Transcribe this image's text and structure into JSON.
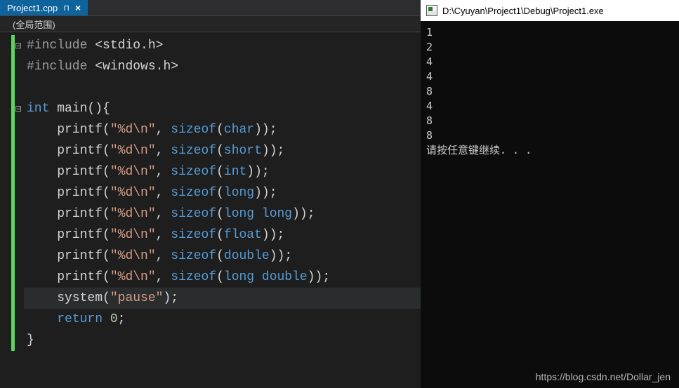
{
  "tab": {
    "filename": "Project1.cpp",
    "close": "×",
    "pin": "⊓"
  },
  "scope": {
    "label": "(全局范围)"
  },
  "code": {
    "lines": [
      {
        "fold": "⊟",
        "tokens": [
          [
            "pre",
            "#include"
          ],
          [
            "id",
            " "
          ],
          [
            "ang",
            "<stdio.h>"
          ]
        ]
      },
      {
        "fold": "",
        "tokens": [
          [
            "pre",
            "#include"
          ],
          [
            "id",
            " "
          ],
          [
            "ang",
            "<windows.h>"
          ]
        ]
      },
      {
        "fold": "",
        "tokens": []
      },
      {
        "fold": "⊟",
        "tokens": [
          [
            "kw",
            "int"
          ],
          [
            "id",
            " main"
          ],
          [
            "punc",
            "()"
          ],
          [
            "punc",
            "{"
          ]
        ]
      },
      {
        "fold": "",
        "tokens": [
          [
            "id",
            "    printf"
          ],
          [
            "punc",
            "("
          ],
          [
            "str",
            "\"%d\\n\""
          ],
          [
            "punc",
            ", "
          ],
          [
            "kw",
            "sizeof"
          ],
          [
            "punc",
            "("
          ],
          [
            "kw",
            "char"
          ],
          [
            "punc",
            "))"
          ],
          [
            "punc",
            ";"
          ]
        ]
      },
      {
        "fold": "",
        "tokens": [
          [
            "id",
            "    printf"
          ],
          [
            "punc",
            "("
          ],
          [
            "str",
            "\"%d\\n\""
          ],
          [
            "punc",
            ", "
          ],
          [
            "kw",
            "sizeof"
          ],
          [
            "punc",
            "("
          ],
          [
            "kw",
            "short"
          ],
          [
            "punc",
            "))"
          ],
          [
            "punc",
            ";"
          ]
        ]
      },
      {
        "fold": "",
        "tokens": [
          [
            "id",
            "    printf"
          ],
          [
            "punc",
            "("
          ],
          [
            "str",
            "\"%d\\n\""
          ],
          [
            "punc",
            ", "
          ],
          [
            "kw",
            "sizeof"
          ],
          [
            "punc",
            "("
          ],
          [
            "kw",
            "int"
          ],
          [
            "punc",
            "))"
          ],
          [
            "punc",
            ";"
          ]
        ]
      },
      {
        "fold": "",
        "tokens": [
          [
            "id",
            "    printf"
          ],
          [
            "punc",
            "("
          ],
          [
            "str",
            "\"%d\\n\""
          ],
          [
            "punc",
            ", "
          ],
          [
            "kw",
            "sizeof"
          ],
          [
            "punc",
            "("
          ],
          [
            "kw",
            "long"
          ],
          [
            "punc",
            "))"
          ],
          [
            "punc",
            ";"
          ]
        ]
      },
      {
        "fold": "",
        "tokens": [
          [
            "id",
            "    printf"
          ],
          [
            "punc",
            "("
          ],
          [
            "str",
            "\"%d\\n\""
          ],
          [
            "punc",
            ", "
          ],
          [
            "kw",
            "sizeof"
          ],
          [
            "punc",
            "("
          ],
          [
            "kw",
            "long long"
          ],
          [
            "punc",
            "))"
          ],
          [
            "punc",
            ";"
          ]
        ]
      },
      {
        "fold": "",
        "tokens": [
          [
            "id",
            "    printf"
          ],
          [
            "punc",
            "("
          ],
          [
            "str",
            "\"%d\\n\""
          ],
          [
            "punc",
            ", "
          ],
          [
            "kw",
            "sizeof"
          ],
          [
            "punc",
            "("
          ],
          [
            "kw",
            "float"
          ],
          [
            "punc",
            "))"
          ],
          [
            "punc",
            ";"
          ]
        ]
      },
      {
        "fold": "",
        "tokens": [
          [
            "id",
            "    printf"
          ],
          [
            "punc",
            "("
          ],
          [
            "str",
            "\"%d\\n\""
          ],
          [
            "punc",
            ", "
          ],
          [
            "kw",
            "sizeof"
          ],
          [
            "punc",
            "("
          ],
          [
            "kw",
            "double"
          ],
          [
            "punc",
            "))"
          ],
          [
            "punc",
            ";"
          ]
        ]
      },
      {
        "fold": "",
        "tokens": [
          [
            "id",
            "    printf"
          ],
          [
            "punc",
            "("
          ],
          [
            "str",
            "\"%d\\n\""
          ],
          [
            "punc",
            ", "
          ],
          [
            "kw",
            "sizeof"
          ],
          [
            "punc",
            "("
          ],
          [
            "kw",
            "long double"
          ],
          [
            "punc",
            "))"
          ],
          [
            "punc",
            ";"
          ]
        ]
      },
      {
        "fold": "",
        "hl": true,
        "tokens": [
          [
            "id",
            "    system"
          ],
          [
            "punc",
            "("
          ],
          [
            "str",
            "\"pause\""
          ],
          [
            "punc",
            ")"
          ],
          [
            "punc",
            ";"
          ]
        ]
      },
      {
        "fold": "",
        "tokens": [
          [
            "id",
            "    "
          ],
          [
            "kw",
            "return"
          ],
          [
            "id",
            " "
          ],
          [
            "num",
            "0"
          ],
          [
            "punc",
            ";"
          ]
        ]
      },
      {
        "fold": "",
        "tokens": [
          [
            "punc",
            "}"
          ]
        ]
      }
    ]
  },
  "console": {
    "title": "D:\\Cyuyan\\Project1\\Debug\\Project1.exe",
    "output_lines": [
      "1",
      "2",
      "4",
      "4",
      "8",
      "4",
      "8",
      "8",
      "请按任意键继续. . ."
    ]
  },
  "watermark": "https://blog.csdn.net/Dollar_jen"
}
